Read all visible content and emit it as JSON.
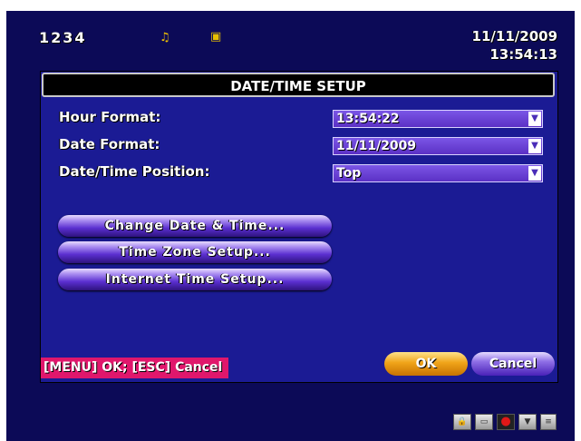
{
  "status_bar": {
    "channels": "1234",
    "date": "11/11/2009",
    "time": "13:54:13",
    "icons": [
      "record-icon",
      "network-icon"
    ]
  },
  "dialog": {
    "title": "DATE/TIME SETUP",
    "fields": [
      {
        "label": "Hour Format:",
        "value": "13:54:22"
      },
      {
        "label": "Date Format:",
        "value": "11/11/2009"
      },
      {
        "label": "Date/Time Position:",
        "value": "Top"
      }
    ],
    "actions": [
      {
        "label": "Change Date & Time..."
      },
      {
        "label": "Time Zone Setup..."
      },
      {
        "label": "Internet Time Setup..."
      }
    ],
    "hint": "[MENU] OK; [ESC] Cancel",
    "ok_label": "OK",
    "cancel_label": "Cancel"
  },
  "tray_icons": [
    "lock-icon",
    "display-icon",
    "record-dot-icon",
    "trash-icon",
    "scroll-icon"
  ],
  "colors": {
    "background": "#0c0a57",
    "dialog": "#1b1b94",
    "hint_bg": "#e0176c",
    "ok_button": "#f0a419",
    "cancel_button": "#6a44d6",
    "dropdown": "#6a40d8"
  }
}
